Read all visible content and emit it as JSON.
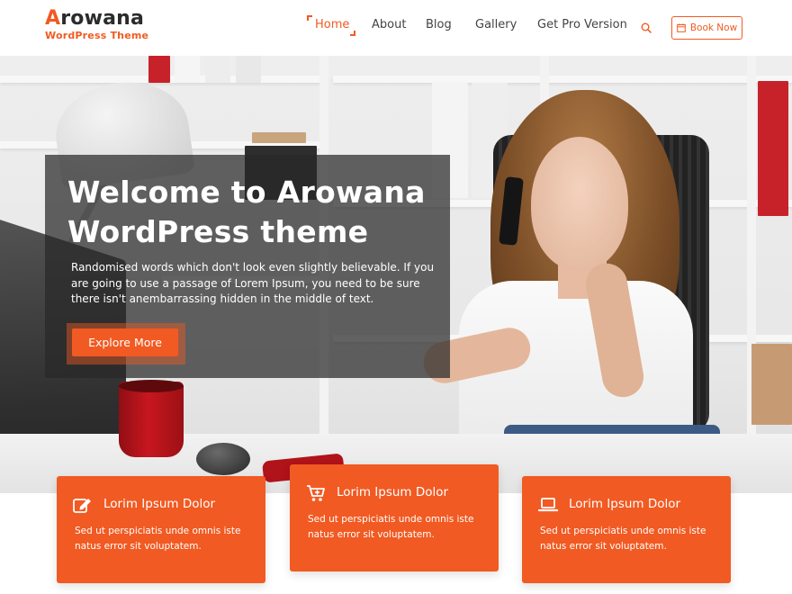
{
  "brand": {
    "first_letter": "A",
    "rest": "rowana",
    "tagline": "WordPress Theme",
    "accent_color": "#f15a22"
  },
  "nav": {
    "items": [
      {
        "label": "Home",
        "active": true
      },
      {
        "label": "About",
        "active": false
      },
      {
        "label": "Blog",
        "active": false
      },
      {
        "label": "Gallery",
        "active": false
      },
      {
        "label": "Get Pro Version",
        "active": false
      }
    ],
    "search_icon": "search-icon",
    "book_button": {
      "label": "Book Now",
      "icon": "calendar-icon"
    }
  },
  "hero": {
    "title_line1": "Welcome to Arowana",
    "title_line2": "WordPress theme",
    "description": "Randomised words which don't look even slightly believable. If you are going to use a passage of Lorem Ipsum, you need to be sure there isn't anembarrassing hidden in the middle of text.",
    "button_label": "Explore More"
  },
  "features": [
    {
      "icon": "edit-icon",
      "title": "Lorim Ipsum Dolor",
      "text": "Sed ut perspiciatis unde omnis iste natus error sit voluptatem."
    },
    {
      "icon": "cart-icon",
      "title": "Lorim Ipsum Dolor",
      "text": "Sed ut perspiciatis unde omnis iste natus error sit voluptatem."
    },
    {
      "icon": "laptop-icon",
      "title": "Lorim Ipsum Dolor",
      "text": "Sed ut perspiciatis unde omnis iste natus error sit voluptatem."
    }
  ]
}
